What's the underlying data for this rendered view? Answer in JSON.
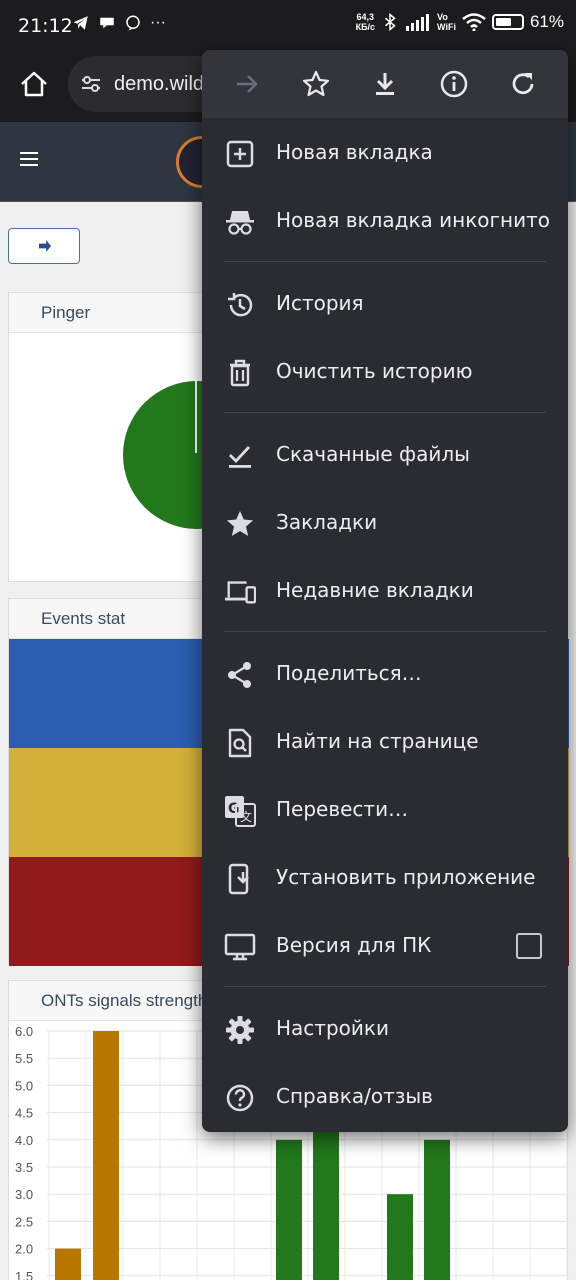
{
  "status_bar": {
    "time": "21:12",
    "more": "···",
    "net_speed_value": "64,3",
    "net_speed_unit": "КБ/с",
    "volte_top": "Vo",
    "volte_bottom": "WiFi",
    "battery_text": "61%",
    "battery_level": 0.61
  },
  "browser": {
    "url": "demo.wildcore.tools"
  },
  "page": {
    "cards": {
      "pinger": "Pinger",
      "events": "Events stat",
      "signals": "ONTs signals strength"
    },
    "events_colors": [
      "#2b5cb0",
      "#d3b03a",
      "#911a1a"
    ],
    "pie_color": "#23781c"
  },
  "chart_data": {
    "type": "bar",
    "title": "ONTs signals strength",
    "ylim": [
      1.5,
      6.0
    ],
    "yticks": [
      "6.0",
      "5.5",
      "5.0",
      "4.5",
      "4.0",
      "3.5",
      "3.0",
      "2.5",
      "2.0",
      "1.5"
    ],
    "series": [
      {
        "color": "#b87800",
        "values": [
          2,
          6
        ]
      },
      {
        "color": "#23781c",
        "values": [
          4,
          6,
          3,
          4
        ]
      }
    ]
  },
  "menu": {
    "toolbar": [
      "forward-arrow",
      "star",
      "download",
      "info",
      "reload"
    ],
    "items": [
      {
        "label": "Новая вкладка",
        "icon": "new-tab"
      },
      {
        "label": "Новая вкладка инкогнито",
        "icon": "incognito"
      },
      {
        "label": "История",
        "icon": "history"
      },
      {
        "label": "Очистить историю",
        "icon": "trash"
      },
      {
        "label": "Скачанные файлы",
        "icon": "downloads"
      },
      {
        "label": "Закладки",
        "icon": "star"
      },
      {
        "label": "Недавние вкладки",
        "icon": "devices"
      },
      {
        "label": "Поделиться…",
        "icon": "share"
      },
      {
        "label": "Найти на странице",
        "icon": "find"
      },
      {
        "label": "Перевести…",
        "icon": "translate"
      },
      {
        "label": "Установить приложение",
        "icon": "install"
      },
      {
        "label": "Версия для ПК",
        "icon": "desktop"
      },
      {
        "label": "Настройки",
        "icon": "gear"
      },
      {
        "label": "Справка/отзыв",
        "icon": "help"
      }
    ]
  }
}
